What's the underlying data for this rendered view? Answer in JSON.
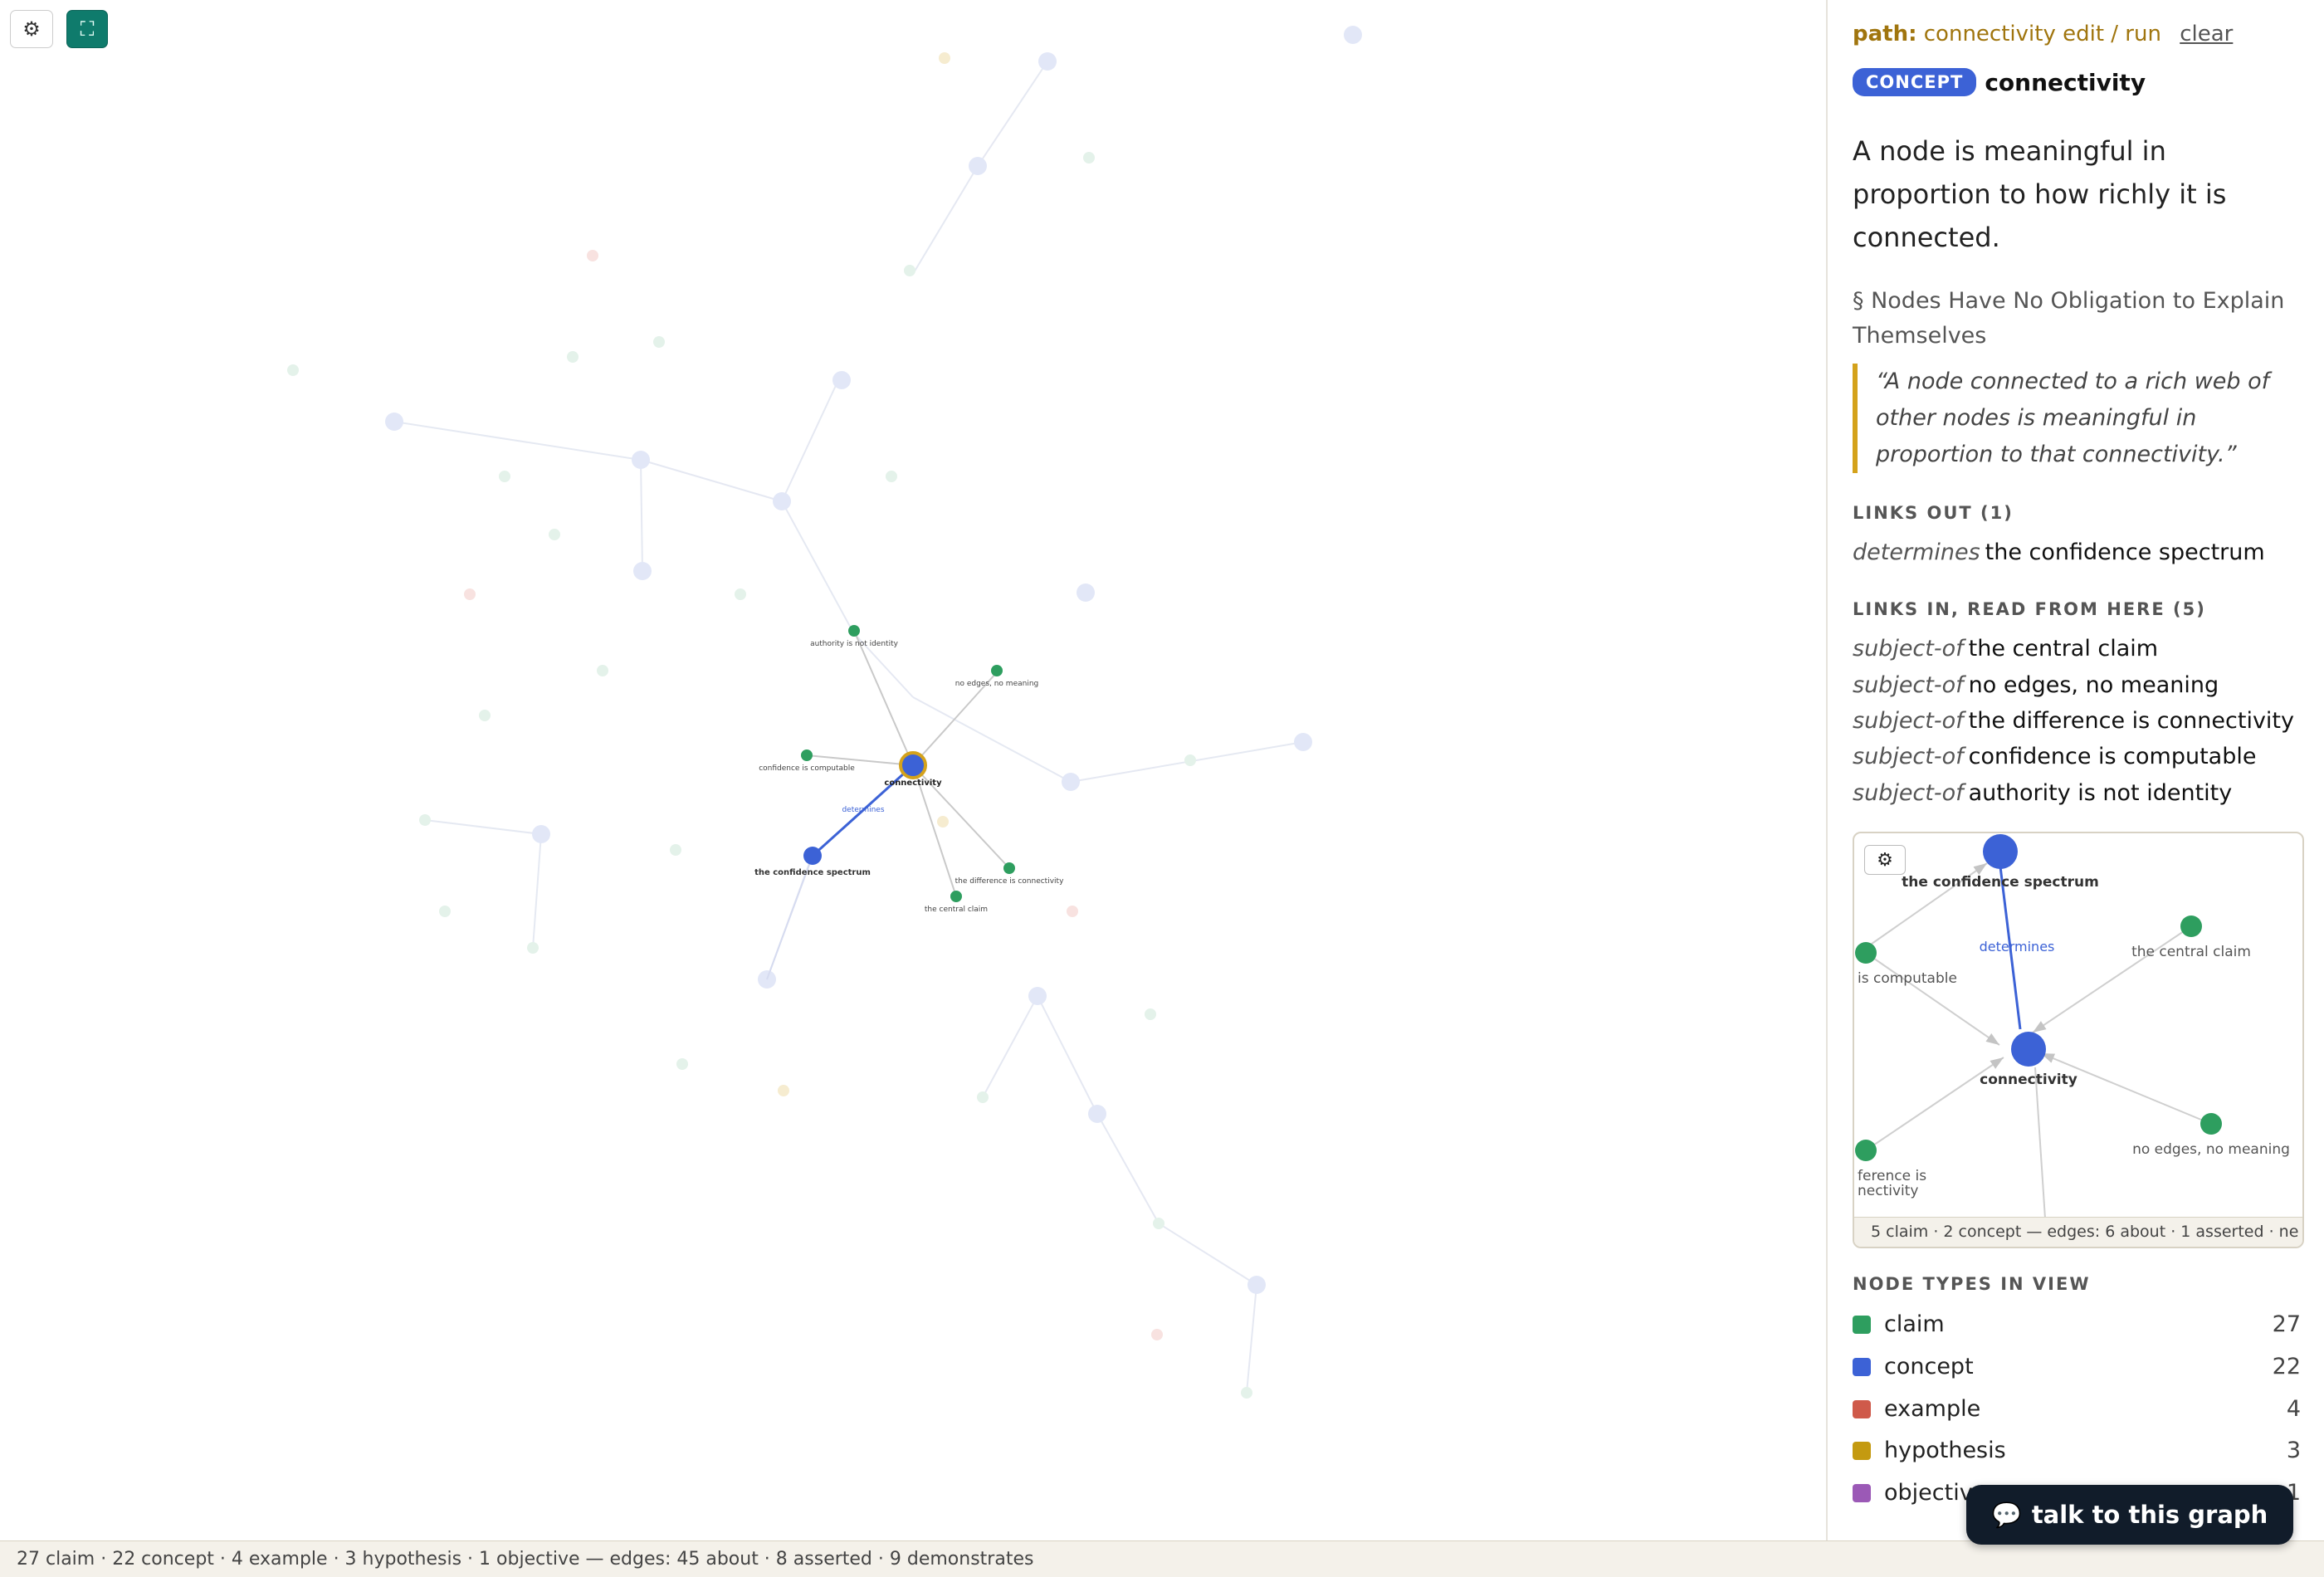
{
  "toolbar": {
    "settings_icon": "gear-icon",
    "fullscreen_icon": "fullscreen-icon",
    "settings_glyph": "⚙",
    "fullscreen_glyph": "⛶"
  },
  "graph": {
    "focus": {
      "label": "connectivity",
      "type": "concept"
    },
    "highlight_nodes": [
      {
        "label": "connectivity",
        "type": "concept",
        "focus": true
      },
      {
        "label": "the confidence spectrum",
        "type": "concept"
      },
      {
        "label": "authority is not identity",
        "type": "claim"
      },
      {
        "label": "no edges, no meaning",
        "type": "claim"
      },
      {
        "label": "confidence is computable",
        "type": "claim"
      },
      {
        "label": "the difference is connectivity",
        "type": "claim"
      },
      {
        "label": "the central claim",
        "type": "claim"
      }
    ],
    "highlight_edge_label": "determines"
  },
  "status_bar": "27 claim · 22 concept · 4 example · 3 hypothesis · 1 objective — edges: 45 about · 8 asserted · 9 demonstrates",
  "panel": {
    "path_label": "path:",
    "path_value": "connectivity edit / run",
    "clear_label": "clear",
    "badge": "CONCEPT",
    "title": "connectivity",
    "description": "A node is meaningful in proportion to how richly it is connected.",
    "section_ref": "§ Nodes Have No Obligation to Explain Themselves",
    "quote": "“A node connected to a rich web of other nodes is meaningful in proportion to that connectivity.”",
    "links_out_heading": "LINKS OUT (1)",
    "links_out": [
      {
        "rel": "determines",
        "target": "the confidence spectrum"
      }
    ],
    "links_in_heading": "LINKS IN, READ FROM HERE (5)",
    "links_in": [
      {
        "rel": "subject-of",
        "target": "the central claim"
      },
      {
        "rel": "subject-of",
        "target": "no edges, no meaning"
      },
      {
        "rel": "subject-of",
        "target": "the difference is connectivity"
      },
      {
        "rel": "subject-of",
        "target": "confidence is computable"
      },
      {
        "rel": "subject-of",
        "target": "authority is not identity"
      }
    ],
    "mini_graph": {
      "settings_glyph": "⚙",
      "labels": {
        "spectrum": "the confidence spectrum",
        "determines": "determines",
        "central": "the central claim",
        "computable": "is computable",
        "connectivity": "connectivity",
        "difference_1": "ference is",
        "difference_2": "nectivity",
        "no_edges": "no edges, no meaning"
      },
      "stats": "5 claim · 2 concept — edges: 6 about · 1 asserted · ne"
    },
    "types_heading": "NODE TYPES IN VIEW",
    "types": [
      {
        "name": "claim",
        "count": "27",
        "color": "#2e9e5f"
      },
      {
        "name": "concept",
        "count": "22",
        "color": "#3c62d6"
      },
      {
        "name": "example",
        "count": "4",
        "color": "#cf5a4a"
      },
      {
        "name": "hypothesis",
        "count": "3",
        "color": "#c49a10"
      },
      {
        "name": "objective",
        "count": "1",
        "color": "#9b59b6"
      }
    ]
  },
  "talk_button": {
    "icon": "speech-bubble-icon",
    "glyph": "💬",
    "label": "talk to this graph"
  },
  "colors": {
    "claim": "#2e9e5f",
    "concept": "#3c62d6",
    "example": "#cf5a4a",
    "hypothesis": "#c49a10",
    "objective": "#9b59b6",
    "accent": "#0f7b6c",
    "focus_ring": "#d4a21b"
  }
}
